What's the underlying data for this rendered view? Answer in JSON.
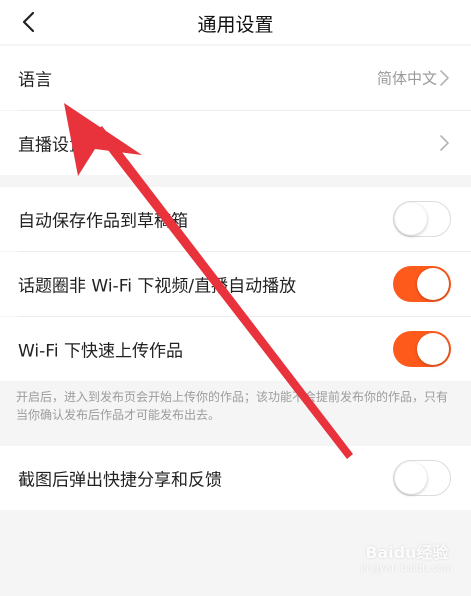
{
  "header": {
    "title": "通用设置",
    "back_icon": "chevron-left-icon"
  },
  "rows": {
    "language": {
      "label": "语言",
      "value": "简体中文"
    },
    "live_settings": {
      "label": "直播设置"
    },
    "auto_save": {
      "label": "自动保存作品到草稿箱",
      "enabled": false
    },
    "auto_play": {
      "label": "话题圈非 Wi-Fi 下视频/直播自动播放",
      "enabled": true
    },
    "fast_upload": {
      "label": "Wi-Fi 下快速上传作品",
      "enabled": true
    },
    "screenshot_share": {
      "label": "截图后弹出快捷分享和反馈",
      "enabled": false
    }
  },
  "note": "开启后，进入到发布页会开始上传你的作品；该功能不会提前发布你的作品，只有当你确认发布后作品才可能发布出去。",
  "colors": {
    "accent": "#fe5a1c",
    "annotation_arrow": "#e8323c"
  },
  "watermark": {
    "text": "Baidu经验",
    "sub": "jingyan.baidu.com"
  }
}
